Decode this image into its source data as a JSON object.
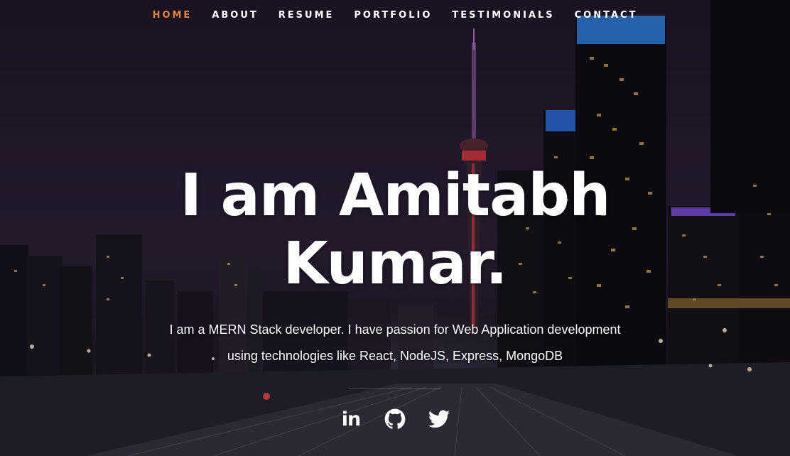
{
  "nav": {
    "items": [
      {
        "label": "HOME",
        "current": true
      },
      {
        "label": "ABOUT",
        "current": false
      },
      {
        "label": "RESUME",
        "current": false
      },
      {
        "label": "PORTFOLIO",
        "current": false
      },
      {
        "label": "TESTIMONIALS",
        "current": false
      },
      {
        "label": "CONTACT",
        "current": false
      }
    ],
    "accent_color": "#e3803a"
  },
  "banner": {
    "headline": "I am Amitabh Kumar.",
    "description": "I am a MERN Stack developer. I have passion for Web Application development using technologies like React, NodeJS, Express, MongoDB"
  },
  "social": [
    {
      "name": "linkedin",
      "icon": "linkedin-icon",
      "text": "in"
    },
    {
      "name": "github",
      "icon": "github-icon"
    },
    {
      "name": "twitter",
      "icon": "twitter-icon"
    }
  ]
}
